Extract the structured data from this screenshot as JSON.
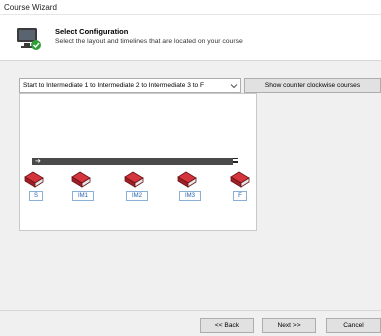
{
  "window": {
    "title": "Course Wizard"
  },
  "header": {
    "title": "Select Configuration",
    "subtitle": "Select the layout and timelines that are located on your course",
    "icon": "wizard-monitor-icon"
  },
  "layout_select": {
    "value": "Start to Intermediate 1 to Intermediate 2 to Intermediate 3 to F"
  },
  "ccw_button": {
    "label": "Show counter clockwise courses"
  },
  "course_preview": {
    "start_icon": "start-arrow-icon",
    "finish_icon": "finish-flag-icon",
    "markers": [
      {
        "label": "S"
      },
      {
        "label": "IM1"
      },
      {
        "label": "IM2"
      },
      {
        "label": "IM3"
      },
      {
        "label": "F"
      }
    ]
  },
  "nav": {
    "back_label": "<< Back",
    "next_label": "Next >>",
    "cancel_label": "Cancel"
  }
}
